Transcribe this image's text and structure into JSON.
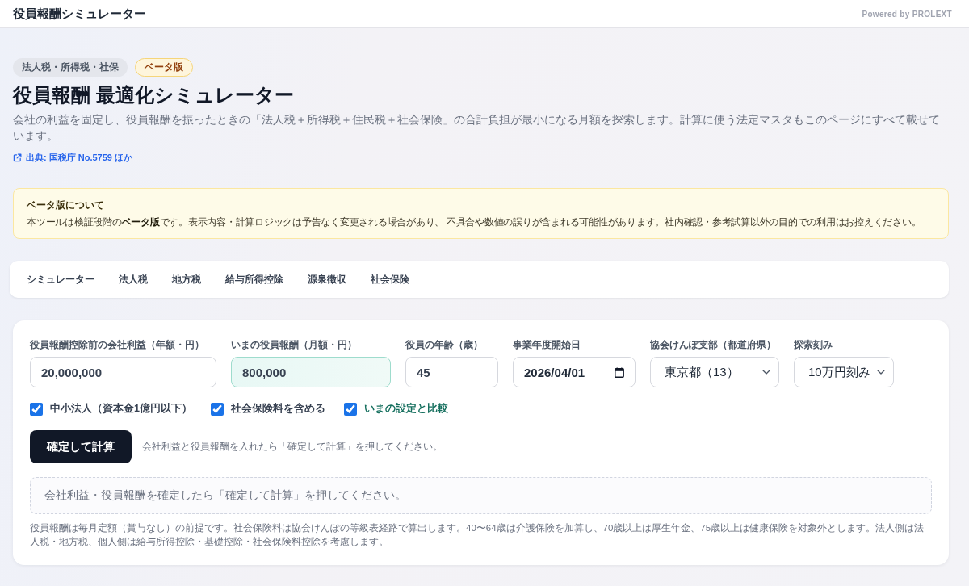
{
  "header": {
    "title": "役員報酬シミュレーター",
    "powered_by": "Powered by PROLEXT"
  },
  "hero": {
    "tags": [
      {
        "label": "法人税・所得税・社保",
        "kind": "category"
      },
      {
        "label": "ベータ版",
        "kind": "beta"
      }
    ],
    "title": "役員報酬 最適化シミュレーター",
    "description": "会社の利益を固定し、役員報酬を振ったときの「法人税＋所得税＋住民税＋社会保険」の合計負担が最小になる月額を探索します。計算に使う法定マスタもこのページにすべて載せています。",
    "source_link": "出典: 国税庁 No.5759 ほか"
  },
  "beta_notice": {
    "title": "ベータ版について",
    "body": "本ツールは検証段階の**ベータ版**です。表示内容・計算ロジックは予告なく変更される場合があり、 不具合や数値の誤りが含まれる可能性があります。社内確認・参考試算以外の目的での利用はお控えください。"
  },
  "tabs": [
    {
      "label": "シミュレーター"
    },
    {
      "label": "法人税"
    },
    {
      "label": "地方税"
    },
    {
      "label": "給与所得控除"
    },
    {
      "label": "源泉徴収"
    },
    {
      "label": "社会保険"
    }
  ],
  "form": {
    "fields": [
      {
        "kind": "number",
        "label": "役員報酬控除前の会社利益（年額・円）",
        "value": "20,000,000",
        "highlighted": false
      },
      {
        "kind": "number",
        "label": "いまの役員報酬（月額・円）",
        "value": "800,000",
        "highlighted": true
      },
      {
        "kind": "number",
        "label": "役員の年齢（歳）",
        "value": "45",
        "highlighted": false
      },
      {
        "kind": "date",
        "label": "事業年度開始日",
        "value": "2026/04/01",
        "highlighted": false
      },
      {
        "kind": "select",
        "label": "協会けんぽ支部（都道府県）",
        "value": "東京都（13）",
        "highlighted": false
      },
      {
        "kind": "select",
        "label": "探索刻み",
        "value": "10万円刻み",
        "highlighted": false
      }
    ],
    "options": [
      {
        "label": "中小法人（資本金1億円以下）",
        "checked": true,
        "emphasized": false
      },
      {
        "label": "社会保険料を含める",
        "checked": true,
        "emphasized": false
      },
      {
        "label": "いまの設定と比較",
        "checked": true,
        "emphasized": true
      }
    ],
    "submit": {
      "label": "確定して計算",
      "hint": "会社利益と役員報酬を入れたら「確定して計算」を押してください。"
    },
    "result_placeholder": "会社利益・役員報酬を確定したら「確定して計算」を押してください。",
    "footnote": "役員報酬は毎月定額（賞与なし）の前提です。社会保険料は協会けんぽの等級表経路で算出します。40〜64歳は介護保険を加算し、70歳以上は厚生年金、75歳以上は健康保険を対象外とします。法人側は法人税・地方税、個人側は給与所得控除・基礎控除・社会保険料控除を考慮します。"
  }
}
